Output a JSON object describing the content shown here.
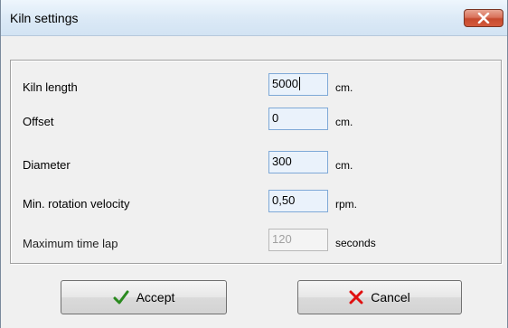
{
  "window": {
    "title": "Kiln settings",
    "close_icon": "close-icon"
  },
  "fields": [
    {
      "label": "Kiln length",
      "value": "5000",
      "unit": "cm.",
      "enabled": true,
      "focused": true
    },
    {
      "label": "Offset",
      "value": "0",
      "unit": "cm.",
      "enabled": true
    },
    {
      "label": "Diameter",
      "value": "300",
      "unit": "cm.",
      "enabled": true
    },
    {
      "label": "Min. rotation velocity",
      "value": "0,50",
      "unit": "rpm.",
      "enabled": true
    },
    {
      "label": "Maximum time lap",
      "value": "120",
      "unit": "seconds",
      "enabled": false
    }
  ],
  "buttons": {
    "accept": {
      "label": "Accept",
      "icon": "checkmark-icon",
      "color": "#2a8a1f"
    },
    "cancel": {
      "label": "Cancel",
      "icon": "x-icon",
      "color": "#e01010"
    }
  }
}
